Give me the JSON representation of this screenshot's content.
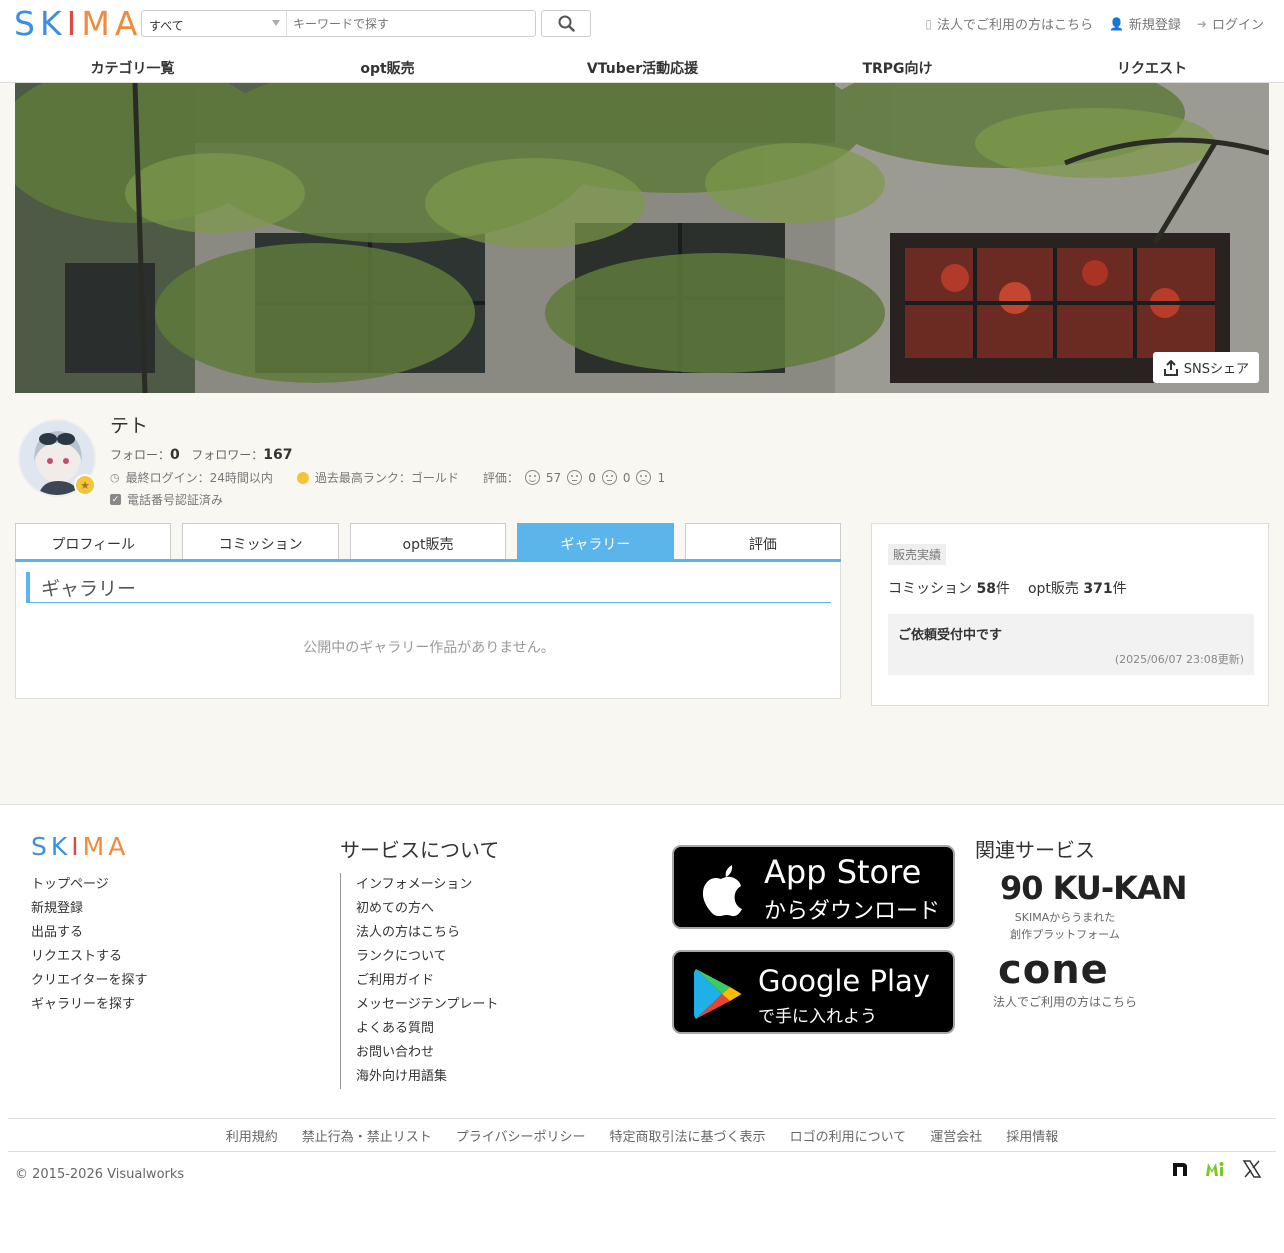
{
  "header": {
    "logo": [
      "S",
      "K",
      "I",
      "M",
      "A"
    ],
    "search": {
      "category": "すべて",
      "placeholder": "キーワードで探す"
    },
    "links": {
      "corporate": "法人でご利用の方はこちら",
      "register": "新規登録",
      "login": "ログイン"
    },
    "nav": [
      "カテゴリ一覧",
      "opt販売",
      "VTuber活動応援",
      "TRPG向け",
      "リクエスト"
    ]
  },
  "banner": {
    "share": "SNSシェア"
  },
  "profile": {
    "name": "テト",
    "follow_label": "フォロー：",
    "follow_count": "0",
    "follower_label": "フォロワー：",
    "follower_count": "167",
    "last_login": "最終ログイン：24時間以内",
    "rank": "過去最高ランク：ゴールド",
    "rating_label": "評価：",
    "ratings": {
      "good": "57",
      "normal": "0",
      "neutral": "0",
      "bad": "1"
    },
    "verified": "電話番号認証済み"
  },
  "tabs": [
    "プロフィール",
    "コミッション",
    "opt販売",
    "ギャラリー",
    "評価"
  ],
  "gallery": {
    "title": "ギャラリー",
    "empty": "公開中のギャラリー作品がありません。"
  },
  "sales": {
    "label": "販売実績",
    "commission_label": "コミッション",
    "commission_count": "58",
    "opt_label": "opt販売",
    "opt_count": "371",
    "unit": "件",
    "request_status": "ご依頼受付中です",
    "updated": "(2025/06/07 23:08更新)"
  },
  "footer": {
    "logo": [
      "S",
      "K",
      "I",
      "M",
      "A"
    ],
    "links1": [
      "トップページ",
      "新規登録",
      "出品する",
      "リクエストする",
      "クリエイターを探す",
      "ギャラリーを探す"
    ],
    "service_title": "サービスについて",
    "links2": [
      "インフォメーション",
      "初めての方へ",
      "法人の方はこちら",
      "ランクについて",
      "ご利用ガイド",
      "メッセージテンプレート",
      "よくある質問",
      "お問い合わせ",
      "海外向け用語集"
    ],
    "appstore": {
      "big": "App Store",
      "small": "からダウンロード"
    },
    "googleplay": {
      "big": "Google Play",
      "small": "で手に入れよう"
    },
    "related_title": "関連サービス",
    "kukan": {
      "name": "90 KU-KAN",
      "sub1": "SKIMAからうまれた",
      "sub2": "創作プラットフォーム"
    },
    "cone": {
      "name": "cone",
      "sub": "法人でご利用の方はこちら"
    },
    "legal": [
      "利用規約",
      "禁止行為・禁止リスト",
      "プライバシーポリシー",
      "特定商取引法に基づく表示",
      "ロゴの利用について",
      "運営会社",
      "採用情報"
    ],
    "copyright": "© 2015-2026 Visualworks",
    "social": [
      "note-icon",
      "misskey-icon",
      "x-icon"
    ]
  }
}
